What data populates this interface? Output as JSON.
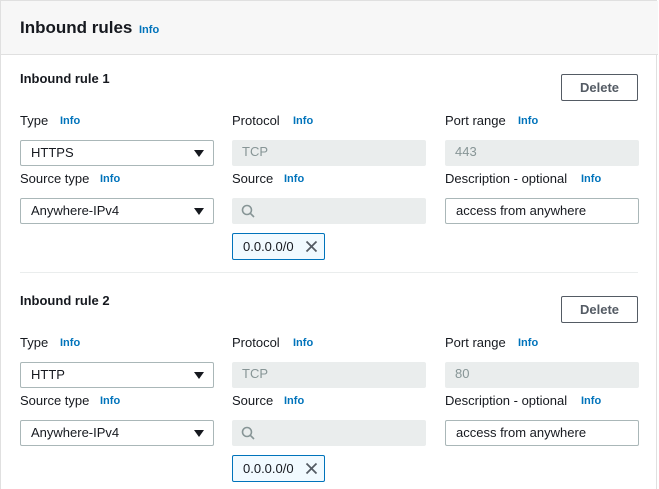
{
  "header": {
    "title": "Inbound rules",
    "info": "Info"
  },
  "rules": [
    {
      "title": "Inbound rule 1",
      "delete_label": "Delete",
      "type_label": "Type",
      "type_info": "Info",
      "type_value": "HTTPS",
      "protocol_label": "Protocol",
      "protocol_info": "Info",
      "protocol_value": "TCP",
      "port_label": "Port range",
      "port_info": "Info",
      "port_value": "443",
      "source_type_label": "Source type",
      "source_type_info": "Info",
      "source_type_value": "Anywhere-IPv4",
      "source_label": "Source",
      "source_info": "Info",
      "source_value": "",
      "desc_label": "Description - optional",
      "desc_info": "Info",
      "desc_value": "access from anywhere",
      "token": "0.0.0.0/0"
    },
    {
      "title": "Inbound rule 2",
      "delete_label": "Delete",
      "type_label": "Type",
      "type_info": "Info",
      "type_value": "HTTP",
      "protocol_label": "Protocol",
      "protocol_info": "Info",
      "protocol_value": "TCP",
      "port_label": "Port range",
      "port_info": "Info",
      "port_value": "80",
      "source_type_label": "Source type",
      "source_type_info": "Info",
      "source_type_value": "Anywhere-IPv4",
      "source_label": "Source",
      "source_info": "Info",
      "source_value": "",
      "desc_label": "Description - optional",
      "desc_info": "Info",
      "desc_value": "access from anywhere",
      "token": "0.0.0.0/0"
    }
  ],
  "icons": {
    "dropdown": "caret-down-icon",
    "search": "search-icon",
    "remove": "close-icon"
  },
  "colors": {
    "link": "#0073bb",
    "token_border": "#0073bb",
    "disabled_bg": "#eaeded"
  }
}
